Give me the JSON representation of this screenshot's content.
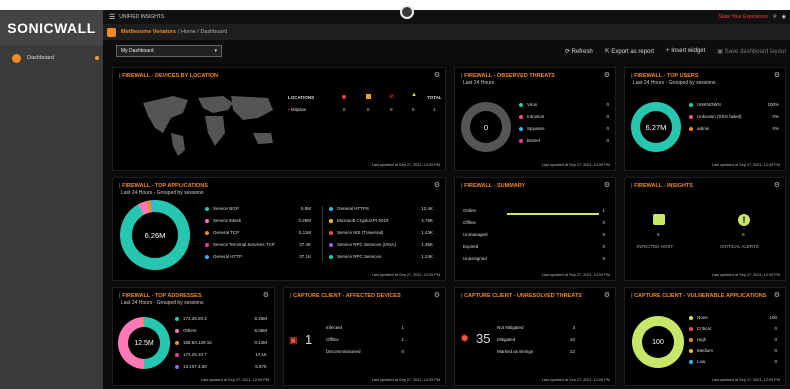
{
  "brand": {
    "logo": "SONICWALL"
  },
  "sidebar": {
    "items": [
      {
        "label": "Dashboard"
      }
    ]
  },
  "header": {
    "app": "UNIFIED INSIGHTS",
    "risk_text": "State Your Experience"
  },
  "breadcrumb": {
    "org": "Mettlesome Venators",
    "path": "/ Home / Dashboard"
  },
  "toolbar": {
    "dashboard": "My Dashboard",
    "refresh": "Refresh",
    "export": "Export as report",
    "insert": "Insert widget",
    "save": "Save dashboard layout"
  },
  "updated": "Last updated at Sep 27, 2021, 12:09 PM",
  "widgets": {
    "devices_by_location": {
      "title": "FIREWALL - DEVICES BY LOCATION",
      "cols": [
        "LOCATIONS",
        "",
        "",
        "",
        "",
        "TOTAL"
      ],
      "rows": [
        {
          "name": "Milpitas",
          "v": [
            "0",
            "0",
            "0",
            "0",
            "1"
          ]
        }
      ]
    },
    "observed_threats": {
      "title": "FIREWALL - OBSERVED THREATS",
      "sub": "Last 24 Hours",
      "center": "0",
      "items": [
        {
          "label": "Virus",
          "value": "0",
          "color": "#26c6b0"
        },
        {
          "label": "Intrusion",
          "value": "0",
          "color": "#ff4c8a"
        },
        {
          "label": "Spyware",
          "value": "0",
          "color": "#2db6e8"
        },
        {
          "label": "Botnet",
          "value": "0",
          "color": "#e040a0"
        }
      ]
    },
    "top_users": {
      "title": "FIREWALL - TOP USERS",
      "sub": "Last 24 Hours - Grouped by sessions",
      "center": "6.27M",
      "items": [
        {
          "label": "UNKNOWN",
          "value": "100%",
          "color": "#26c6b0"
        },
        {
          "label": "Unknown (SSO failed)",
          "value": "0%",
          "color": "#ff4c8a"
        },
        {
          "label": "admin",
          "value": "0%",
          "color": "#f08a24"
        }
      ]
    },
    "top_applications": {
      "title": "FIREWALL - TOP APPLICATIONS",
      "sub": "Last 24 Hours - Grouped by sessions",
      "center": "6.26M",
      "left": [
        {
          "label": "Service BGP",
          "value": "5.8M",
          "color": "#26c6b0"
        },
        {
          "label": "Service iMesh",
          "value": "0.25M",
          "color": "#ff7ab6"
        },
        {
          "label": "General TCP",
          "value": "0.11M",
          "color": "#f08a24"
        },
        {
          "label": "Service Terminal Services TCP",
          "value": "37.4K",
          "color": "#e040a0"
        },
        {
          "label": "General HTTP",
          "value": "37.1K",
          "color": "#2db6e8"
        }
      ],
      "right": [
        {
          "label": "General HTTPS",
          "value": "12.4K",
          "color": "#2db6e8"
        },
        {
          "label": "Microsoft CryptoAPI-2019",
          "value": "4.78K",
          "color": "#f0c020"
        },
        {
          "label": "Service IKE (Traversal)",
          "value": "1.43K",
          "color": "#ff4c4c"
        },
        {
          "label": "Service RPC Services (IANA)",
          "value": "1.35K",
          "color": "#9a6ad8"
        },
        {
          "label": "Service RPC Services",
          "value": "1.24K",
          "color": "#26c6b0"
        }
      ]
    },
    "summary": {
      "title": "FIREWALL - SUMMARY",
      "items": [
        {
          "label": "Online",
          "value": "1"
        },
        {
          "label": "Offline",
          "value": "0"
        },
        {
          "label": "Unmanaged",
          "value": "0"
        },
        {
          "label": "Expired",
          "value": "0"
        },
        {
          "label": "Unassigned",
          "value": "0"
        }
      ]
    },
    "insights": {
      "title": "FIREWALL - INSIGHTS",
      "a_value": "0",
      "a_label": "INFECTED HOST",
      "b_value": "0",
      "b_label": "CRITICAL ALERTS"
    },
    "top_addresses": {
      "title": "FIREWALL - TOP ADDRESSES",
      "sub": "Last 24 Hours - Grouped by sessions",
      "center": "12.5M",
      "items": [
        {
          "label": "172.29.20.4",
          "value": "6.25M",
          "color": "#26c6b0"
        },
        {
          "label": "Others",
          "value": "6.08M",
          "color": "#ff7ab6"
        },
        {
          "label": "168.63.129.16",
          "value": "0.14M",
          "color": "#f08a24"
        },
        {
          "label": "172.29.10.7",
          "value": "17.1K",
          "color": "#e040a0"
        },
        {
          "label": "13.107.4.50",
          "value": "5.67K",
          "color": "#9a6ad8"
        }
      ]
    },
    "affected_devices": {
      "title": "CAPTURE CLIENT - AFFECTED DEVICES",
      "count": "1",
      "items": [
        {
          "label": "Infected",
          "value": "1"
        },
        {
          "label": "Offline",
          "value": "1"
        },
        {
          "label": "Decommissioned",
          "value": "0"
        }
      ]
    },
    "unresolved_threats": {
      "title": "CAPTURE CLIENT - UNRESOLVED THREATS",
      "count": "35",
      "items": [
        {
          "label": "Not Mitigated",
          "value": "3"
        },
        {
          "label": "Mitigated",
          "value": "10"
        },
        {
          "label": "Marked as Benign",
          "value": "22"
        }
      ]
    },
    "vulnerable_apps": {
      "title": "CAPTURE CLIENT - VULNERABLE APPLICATIONS",
      "center": "100",
      "items": [
        {
          "label": "None",
          "value": "100",
          "color": "#c8e66a"
        },
        {
          "label": "Critical",
          "value": "0",
          "color": "#ff4c4c"
        },
        {
          "label": "High",
          "value": "0",
          "color": "#f08a24"
        },
        {
          "label": "Medium",
          "value": "0",
          "color": "#f0c020"
        },
        {
          "label": "Low",
          "value": "0",
          "color": "#2db6e8"
        }
      ]
    }
  }
}
